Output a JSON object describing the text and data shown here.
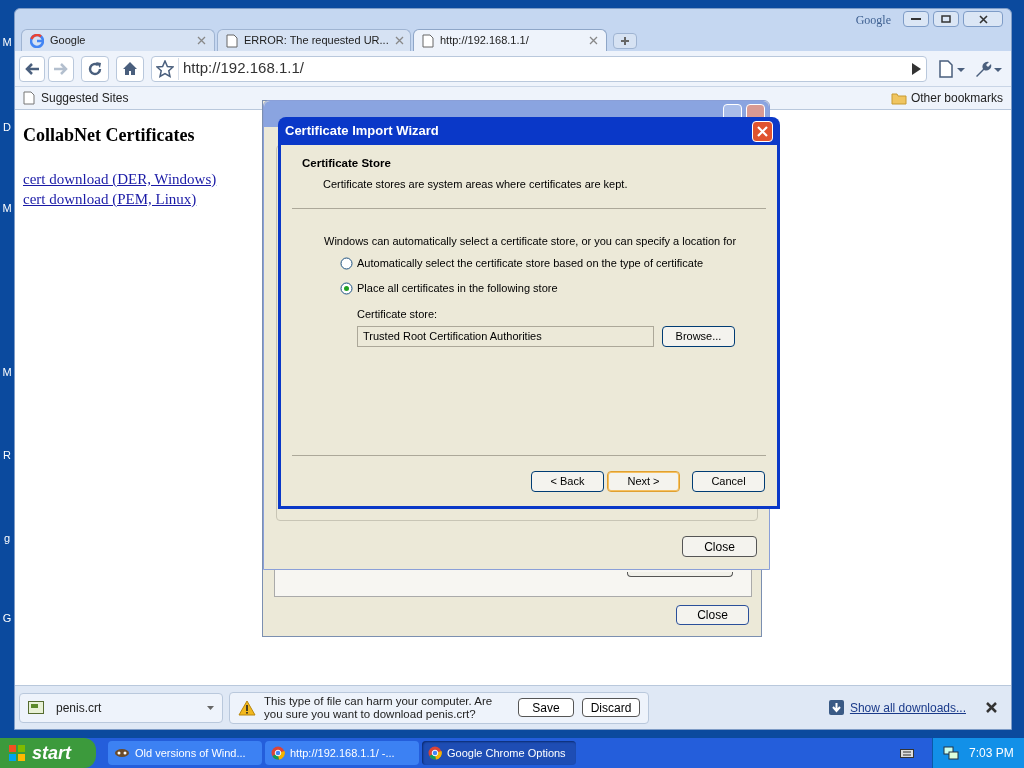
{
  "desktop_labels": [
    "M",
    "D",
    "M",
    "M",
    "R",
    "g",
    "G"
  ],
  "browser": {
    "brand": "Google",
    "tabs": [
      {
        "title": "Google",
        "kind": "google",
        "selected": false
      },
      {
        "title": "ERROR: The requested UR...",
        "kind": "page",
        "selected": false
      },
      {
        "title": "http://192.168.1.1/",
        "kind": "page",
        "selected": true
      }
    ],
    "address": "http://192.168.1.1/",
    "bookmark": "Suggested Sites",
    "other_bookmarks": "Other bookmarks"
  },
  "page": {
    "heading": "CollabNet Certificates",
    "links": [
      "cert download (DER, Windows)",
      "cert download (PEM, Linux)"
    ]
  },
  "options_window": {
    "close": "Close"
  },
  "certificates_window": {
    "close": "Close"
  },
  "wizard": {
    "title": "Certificate Import Wizard",
    "section_title": "Certificate Store",
    "section_subtitle": "Certificate stores are system areas where certificates are kept.",
    "intro": "Windows can automatically select a certificate store, or you can specify a location for",
    "options": [
      {
        "label": "Automatically select the certificate store based on the type of certificate",
        "selected": false
      },
      {
        "label": "Place all certificates in the following store",
        "selected": true
      }
    ],
    "store_label": "Certificate store:",
    "store_value": "Trusted Root Certification Authorities",
    "browse": "Browse...",
    "buttons": [
      {
        "label": "< Back",
        "default": false
      },
      {
        "label": "Next >",
        "default": true
      },
      {
        "label": "Cancel",
        "default": false
      }
    ]
  },
  "download_bar": {
    "file": "penis.crt",
    "warning": "This type of file can harm your computer. Are you sure you want to download penis.crt?",
    "save": "Save",
    "discard": "Discard",
    "show_all": "Show all downloads..."
  },
  "taskbar": {
    "start": "start",
    "tasks": [
      {
        "label": "Old versions of Wind...",
        "kind": "app",
        "selected": false
      },
      {
        "label": "http://192.168.1.1/ -...",
        "kind": "chrome",
        "selected": false
      },
      {
        "label": "Google Chrome Options",
        "kind": "chrome",
        "selected": true
      }
    ],
    "clock": "7:03 PM"
  }
}
